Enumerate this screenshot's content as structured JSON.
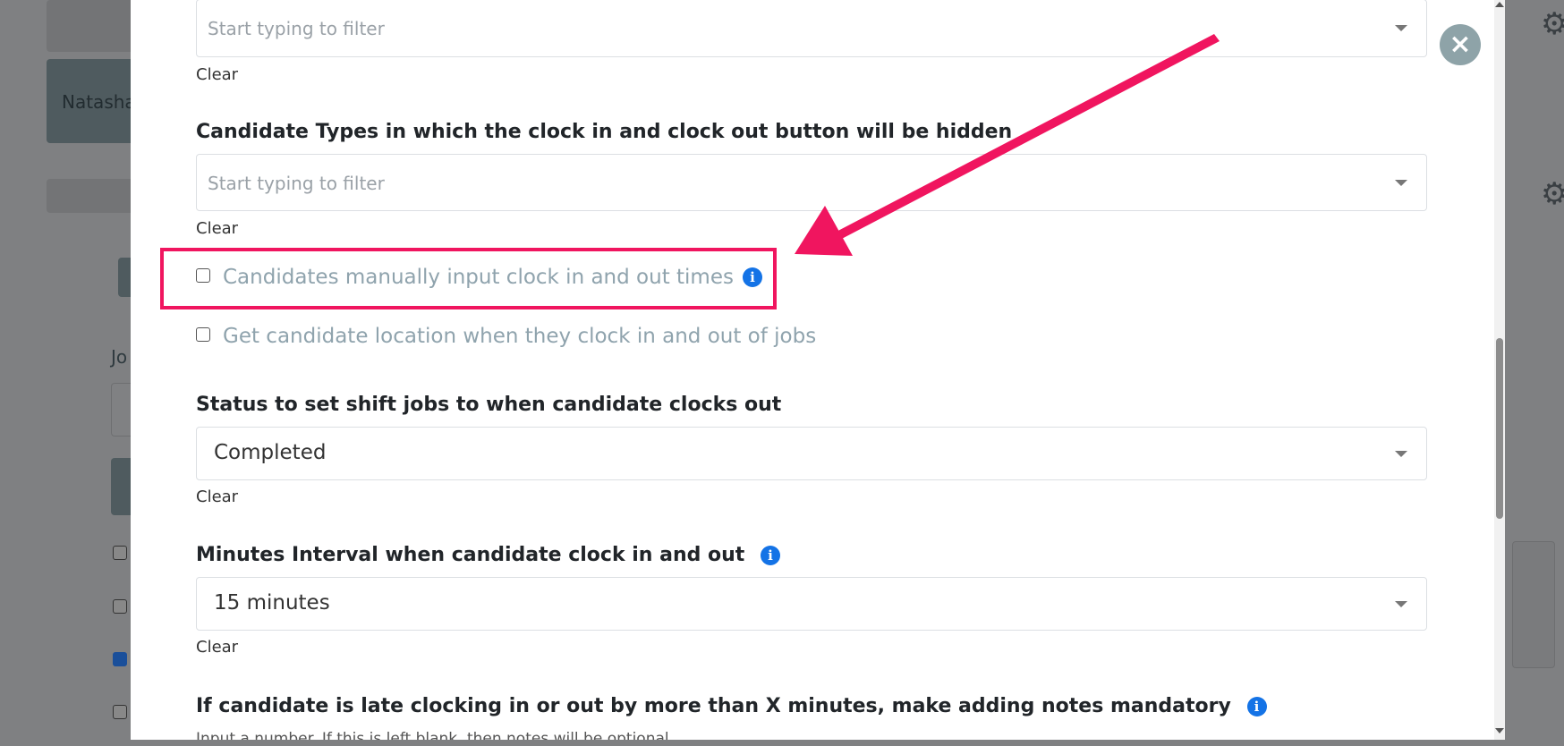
{
  "background": {
    "user_name_partial": "Natasha",
    "label_partial": "Jo"
  },
  "modal": {
    "fields": {
      "filter1": {
        "placeholder": "Start typing to filter",
        "clear": "Clear"
      },
      "candidate_types": {
        "label": "Candidate Types in which the clock in and clock out button will be hidden",
        "placeholder": "Start typing to filter",
        "clear": "Clear"
      },
      "manual_input": {
        "label": "Candidates manually input clock in and out times",
        "checked": false
      },
      "location": {
        "label": "Get candidate location when they clock in and out of jobs",
        "checked": false
      },
      "status": {
        "label": "Status to set shift jobs to when candidate clocks out",
        "value": "Completed",
        "clear": "Clear"
      },
      "interval": {
        "label": "Minutes Interval when candidate clock in and out",
        "value": "15 minutes",
        "clear": "Clear"
      },
      "late": {
        "label": "If candidate is late clocking in or out by more than X minutes, make adding notes mandatory",
        "hint_partial": "Input a number. If this is left blank, then notes will be optional"
      }
    },
    "close_icon": "×",
    "info_icon": "i"
  },
  "colors": {
    "highlight": "#f0155f",
    "info": "#1473e6",
    "close": "#8ea3a8"
  }
}
